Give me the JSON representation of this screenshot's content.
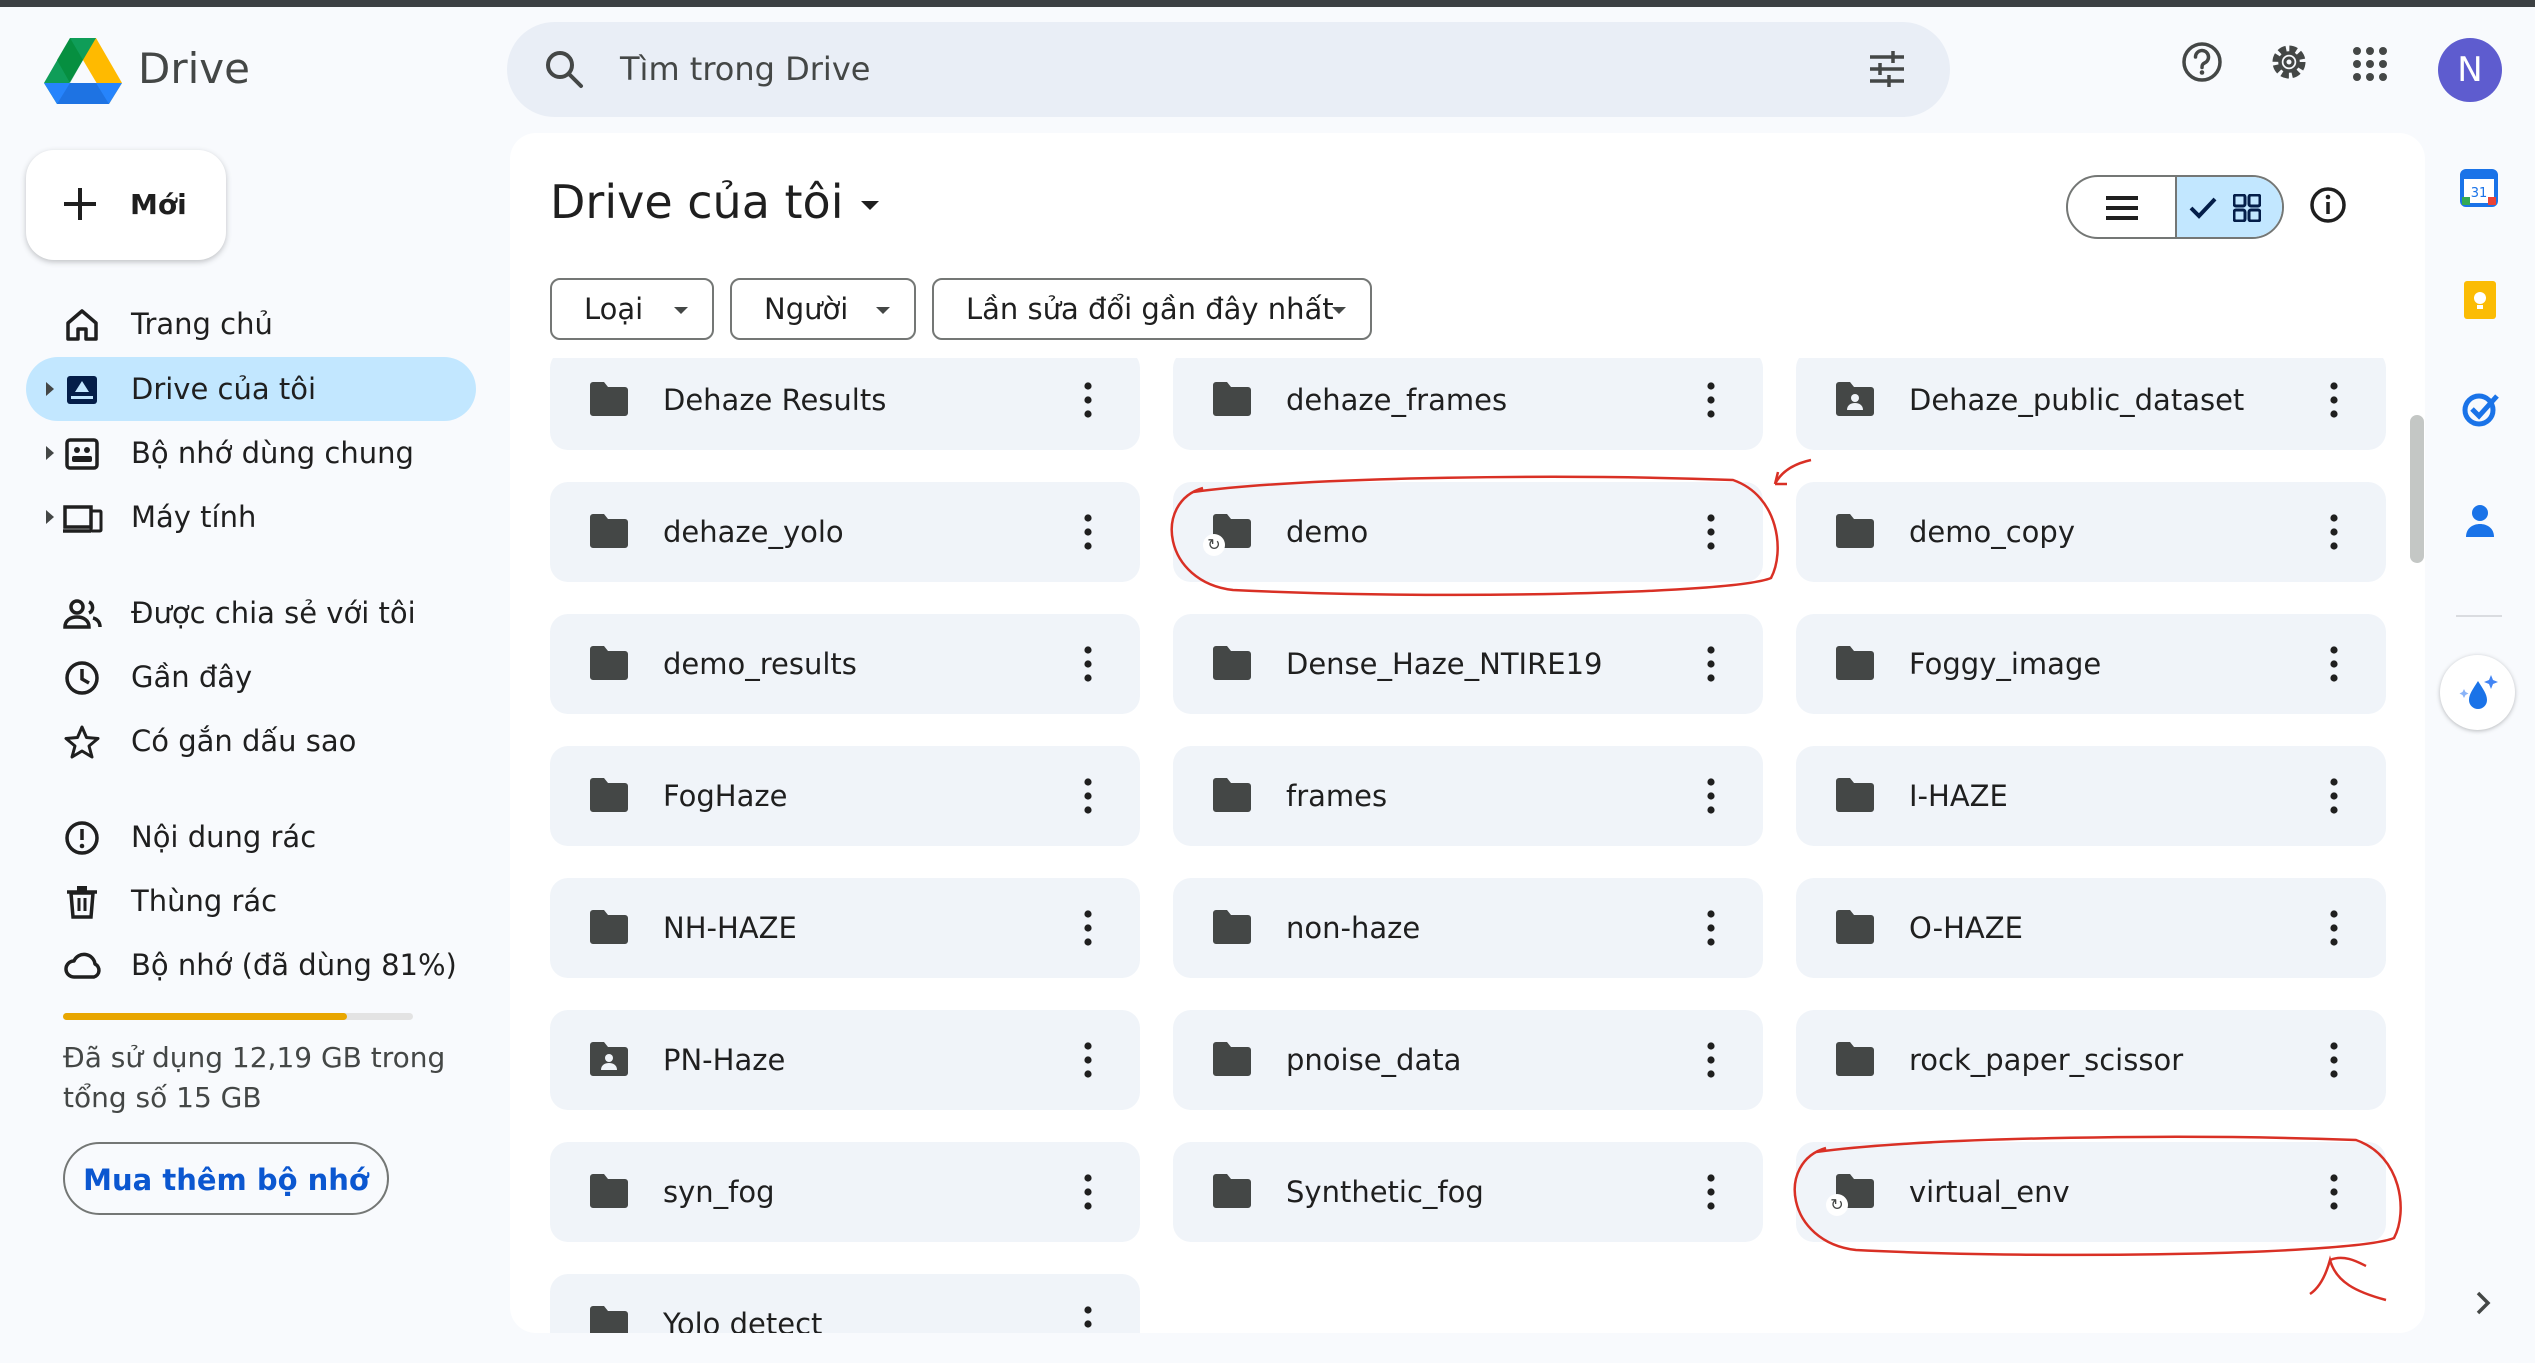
{
  "app": {
    "name": "Drive"
  },
  "search": {
    "placeholder": "Tìm trong Drive"
  },
  "header": {
    "avatar_letter": "N",
    "icons": [
      "help-icon",
      "settings-icon",
      "apps-grid-icon"
    ]
  },
  "sidebar": {
    "new_label": "Mới",
    "nav": [
      {
        "label": "Trang chủ",
        "icon": "home-icon"
      },
      {
        "label": "Drive của tôi",
        "icon": "my-drive-icon",
        "active": true
      },
      {
        "label": "Bộ nhớ dùng chung",
        "icon": "shared-drives-icon"
      },
      {
        "label": "Máy tính",
        "icon": "computers-icon"
      },
      {
        "label": "Được chia sẻ với tôi",
        "icon": "shared-with-me-icon"
      },
      {
        "label": "Gần đây",
        "icon": "clock-icon"
      },
      {
        "label": "Có gắn dấu sao",
        "icon": "star-icon"
      },
      {
        "label": "Nội dung rác",
        "icon": "spam-icon"
      },
      {
        "label": "Thùng rác",
        "icon": "trash-icon"
      },
      {
        "label": "Bộ nhớ (đã dùng 81%)",
        "icon": "cloud-icon"
      }
    ],
    "storage": {
      "used_fraction": 0.81,
      "text": "Đã sử dụng 12,19 GB trong tổng số 15 GB"
    },
    "buy_label": "Mua thêm bộ nhớ"
  },
  "main": {
    "title": "Drive của tôi",
    "filters": [
      "Loại",
      "Người",
      "Lần sửa đổi gần đây nhất"
    ],
    "view": "grid",
    "folders": [
      {
        "name": "Dehaze Results",
        "shared": false,
        "syncing": false
      },
      {
        "name": "dehaze_frames",
        "shared": false,
        "syncing": false
      },
      {
        "name": "Dehaze_public_dataset",
        "shared": true,
        "syncing": false
      },
      {
        "name": "dehaze_yolo",
        "shared": false,
        "syncing": false
      },
      {
        "name": "demo",
        "shared": false,
        "syncing": true,
        "circled": true
      },
      {
        "name": "demo_copy",
        "shared": false,
        "syncing": false
      },
      {
        "name": "demo_results",
        "shared": false,
        "syncing": false
      },
      {
        "name": "Dense_Haze_NTIRE19",
        "shared": false,
        "syncing": false
      },
      {
        "name": "Foggy_image",
        "shared": false,
        "syncing": false
      },
      {
        "name": "FogHaze",
        "shared": false,
        "syncing": false
      },
      {
        "name": "frames",
        "shared": false,
        "syncing": false
      },
      {
        "name": "I-HAZE",
        "shared": false,
        "syncing": false
      },
      {
        "name": "NH-HAZE",
        "shared": false,
        "syncing": false
      },
      {
        "name": "non-haze",
        "shared": false,
        "syncing": false
      },
      {
        "name": "O-HAZE",
        "shared": false,
        "syncing": false
      },
      {
        "name": "PN-Haze",
        "shared": true,
        "syncing": false
      },
      {
        "name": "pnoise_data",
        "shared": false,
        "syncing": false
      },
      {
        "name": "rock_paper_scissor",
        "shared": false,
        "syncing": false
      },
      {
        "name": "syn_fog",
        "shared": false,
        "syncing": false
      },
      {
        "name": "Synthetic_fog",
        "shared": false,
        "syncing": false
      },
      {
        "name": "virtual_env",
        "shared": false,
        "syncing": true,
        "circled": true
      },
      {
        "name": "Yolo detect",
        "shared": false,
        "syncing": false
      }
    ]
  },
  "side_panel": {
    "apps": [
      "calendar-icon",
      "keep-icon",
      "tasks-icon",
      "contacts-icon",
      "gemini-icon"
    ],
    "calendar_day": "31",
    "colors": {
      "calendar": "#1a73e8",
      "keep": "#fbbc04",
      "tasks": "#1a73e8",
      "contacts": "#1a73e8"
    }
  },
  "colors": {
    "accent": "#0b57d0",
    "active_nav": "#c2e7ff",
    "annotation": "#d93025",
    "quota": "#e8a600"
  }
}
